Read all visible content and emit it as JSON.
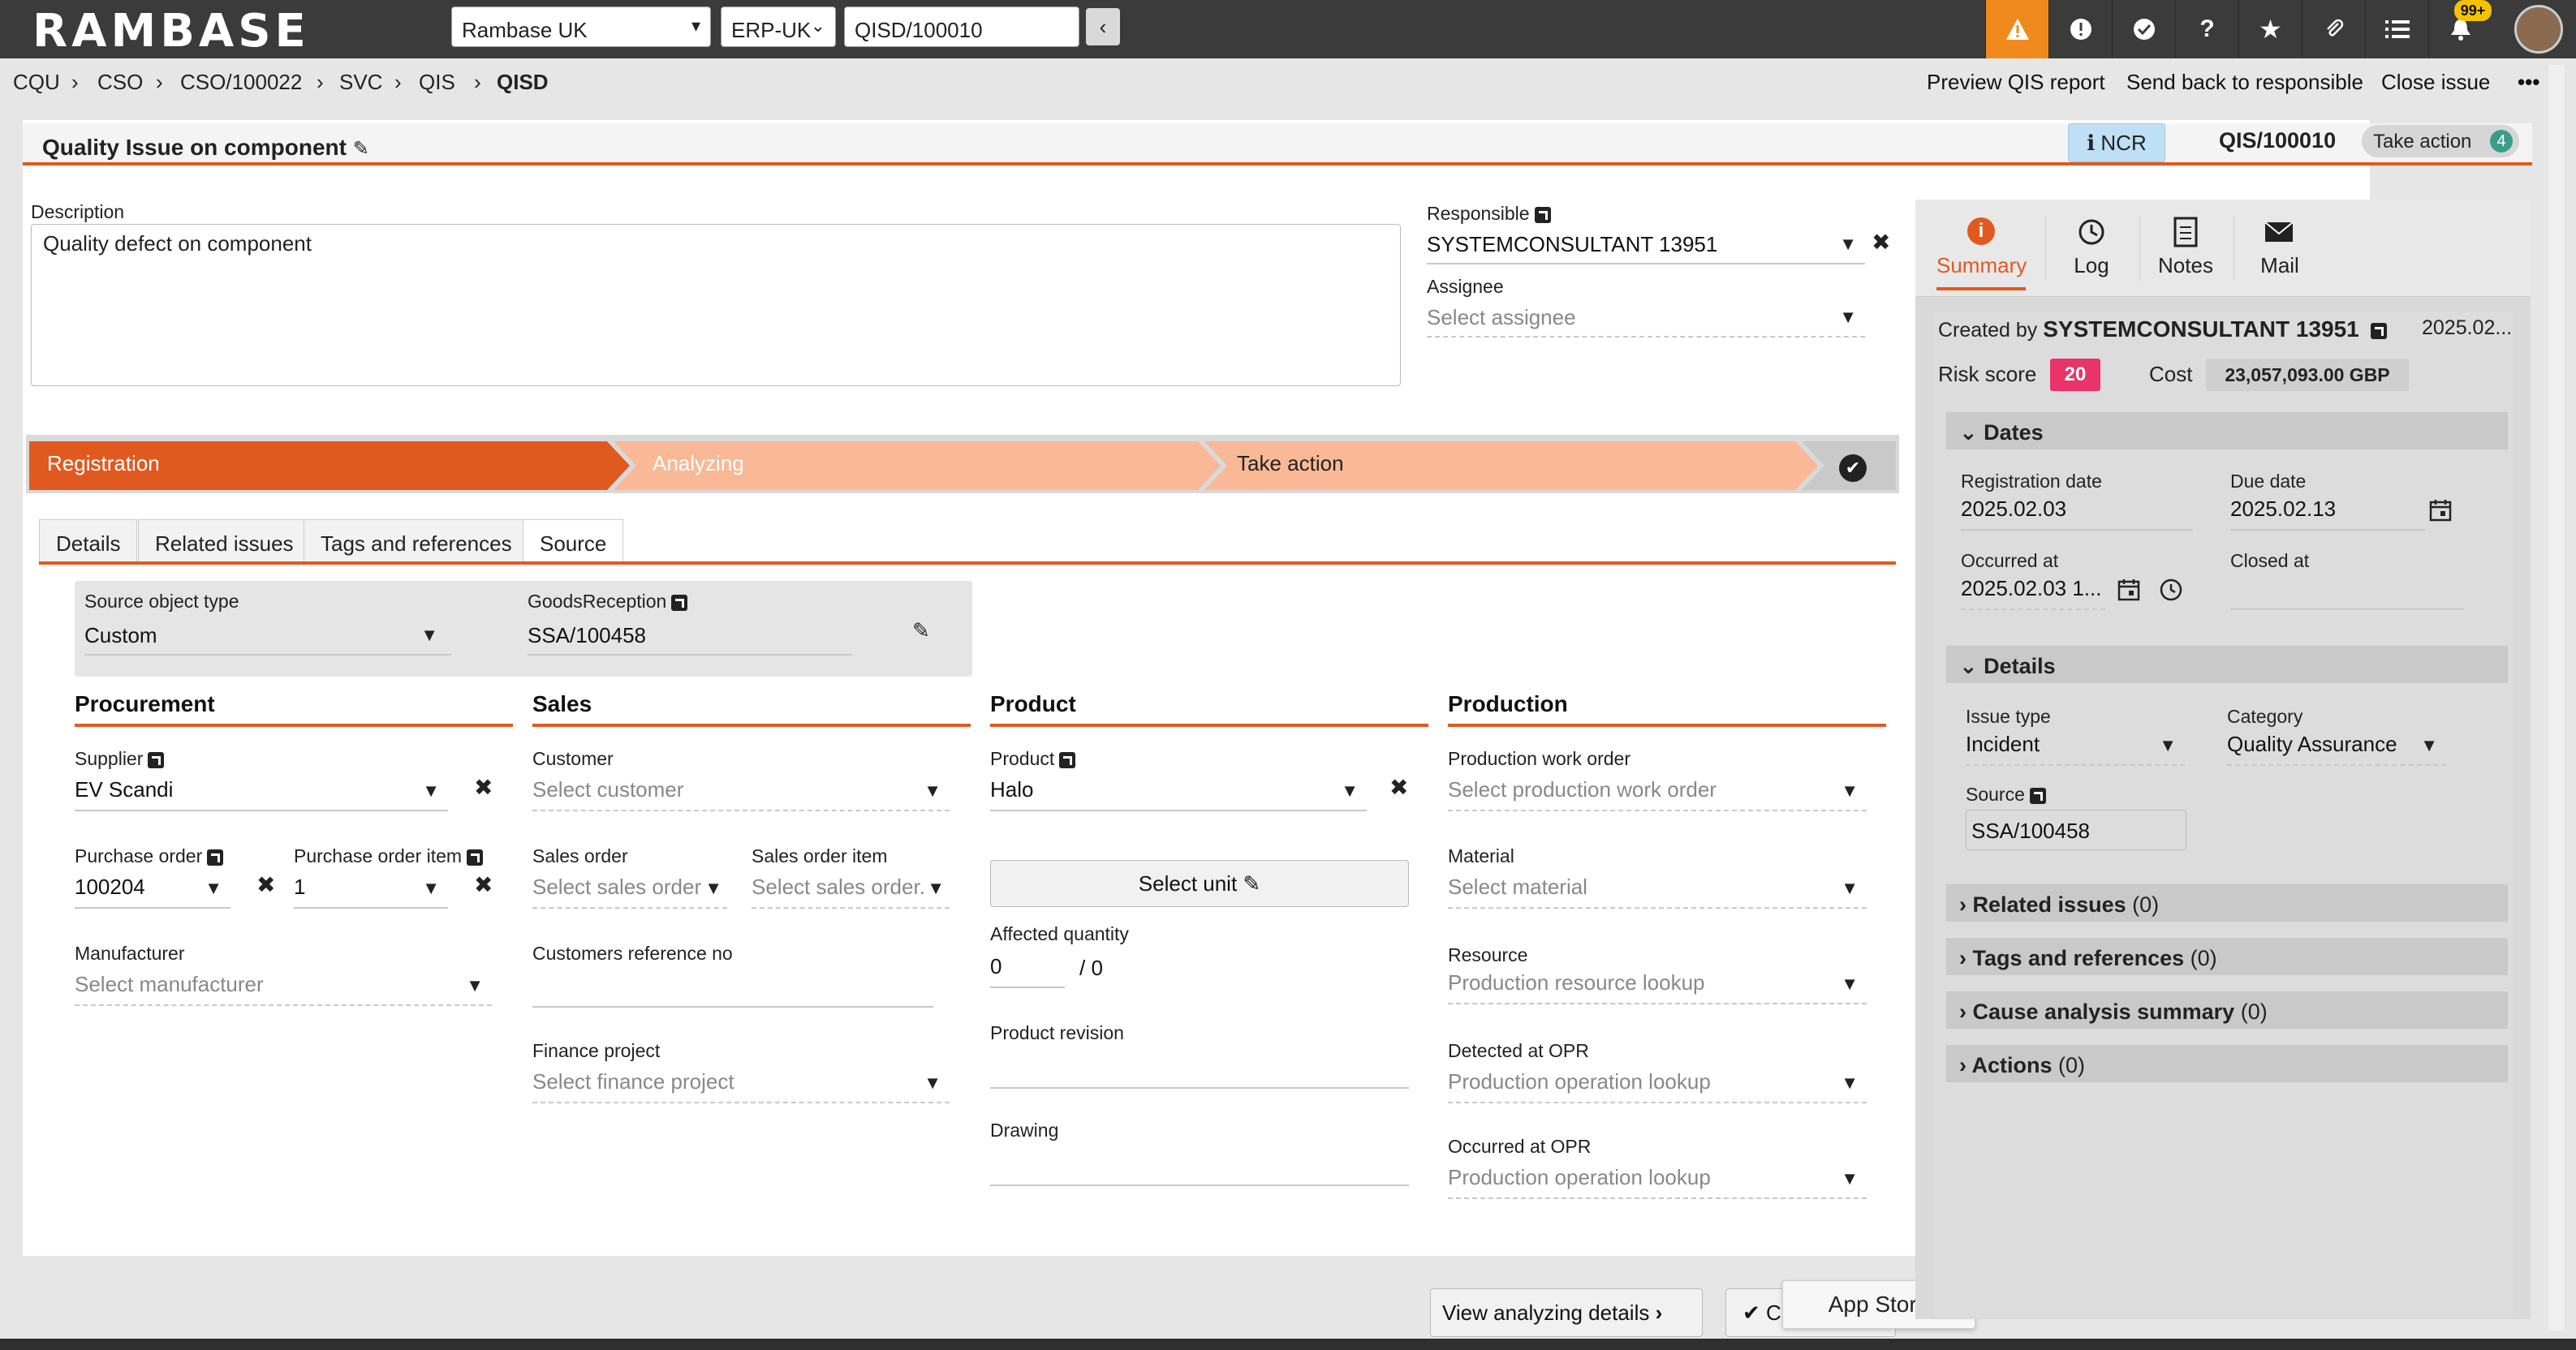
{
  "app": {
    "logo": "RAMBASE",
    "company": "Rambase UK",
    "system": "ERP-UK",
    "doc_search": "QISD/100010",
    "notif_badge": "99+"
  },
  "colors": {
    "accent": "#e05a1f",
    "warning_bg": "#f08a1d",
    "ncr_bg": "#bfdff5",
    "risk": "#e8336b",
    "step_light": "#f9b896"
  },
  "breadcrumb": [
    "CQU",
    "CSO",
    "CSO/100022",
    "SVC",
    "QIS",
    "QISD"
  ],
  "actions": {
    "preview": "Preview QIS report",
    "send_back": "Send back to responsible",
    "close_issue": "Close issue",
    "more": "•••"
  },
  "header": {
    "title": "Quality Issue on component",
    "ncr": "NCR",
    "doc_id": "QIS/100010",
    "take_action": "Take action",
    "take_action_count": "4"
  },
  "description": {
    "label": "Description",
    "value": "Quality defect on component"
  },
  "responsible": {
    "label": "Responsible",
    "value": "SYSTEMCONSULTANT 13951",
    "assignee_label": "Assignee",
    "assignee_ph": "Select assignee"
  },
  "steps": [
    "Registration",
    "Analyzing",
    "Take action"
  ],
  "tabs": [
    "Details",
    "Related issues",
    "Tags and references",
    "Source"
  ],
  "source": {
    "type_label": "Source object type",
    "type_value": "Custom",
    "goods_label": "GoodsReception",
    "goods_value": "SSA/100458"
  },
  "procurement": {
    "title": "Procurement",
    "supplier_label": "Supplier",
    "supplier_value": "EV Scandi",
    "po_label": "Purchase order",
    "po_value": "100204",
    "poi_label": "Purchase order item",
    "poi_value": "1",
    "mfr_label": "Manufacturer",
    "mfr_ph": "Select manufacturer"
  },
  "sales": {
    "title": "Sales",
    "customer_label": "Customer",
    "customer_ph": "Select customer",
    "so_label": "Sales order",
    "so_ph": "Select sales order",
    "soi_label": "Sales order item",
    "soi_ph": "Select sales order...",
    "custref_label": "Customers reference no",
    "finproj_label": "Finance project",
    "finproj_ph": "Select finance project"
  },
  "product": {
    "title": "Product",
    "product_label": "Product",
    "product_value": "Halo",
    "select_unit": "Select unit",
    "affected_label": "Affected quantity",
    "affected_value": "0",
    "affected_total": "/ 0",
    "revision_label": "Product revision",
    "drawing_label": "Drawing"
  },
  "production": {
    "title": "Production",
    "pwo_label": "Production work order",
    "pwo_ph": "Select production work order",
    "material_label": "Material",
    "material_ph": "Select material",
    "resource_label": "Resource",
    "resource_ph": "Production resource lookup",
    "detected_label": "Detected at OPR",
    "detected_ph": "Production operation lookup",
    "occurred_label": "Occurred at OPR",
    "occurred_ph": "Production operation lookup"
  },
  "footer": {
    "view_analyzing": "View analyzing details",
    "close": "Close",
    "app_store": "App Store"
  },
  "side_tabs": [
    "Summary",
    "Log",
    "Notes",
    "Mail"
  ],
  "summary": {
    "created_by_label": "Created by",
    "created_by": "SYSTEMCONSULTANT 13951",
    "created_date": "2025.02...",
    "risk_label": "Risk score",
    "risk_value": "20",
    "cost_label": "Cost",
    "cost_value": "23,057,093.00 GBP",
    "dates_title": "Dates",
    "reg_label": "Registration date",
    "reg_value": "2025.02.03",
    "due_label": "Due date",
    "due_value": "2025.02.13",
    "occ_label": "Occurred at",
    "occ_value": "2025.02.03 1...",
    "closed_label": "Closed at",
    "details_title": "Details",
    "issue_type_label": "Issue type",
    "issue_type_value": "Incident",
    "category_label": "Category",
    "category_value": "Quality Assurance",
    "source_label": "Source",
    "source_value": "SSA/100458",
    "sections": [
      {
        "title": "Related issues",
        "count": "(0)"
      },
      {
        "title": "Tags and references",
        "count": "(0)"
      },
      {
        "title": "Cause analysis summary",
        "count": "(0)"
      },
      {
        "title": "Actions",
        "count": "(0)"
      }
    ]
  }
}
